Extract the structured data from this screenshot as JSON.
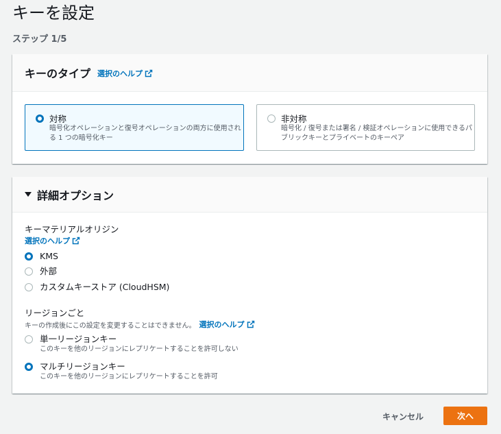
{
  "page": {
    "title": "キーを設定",
    "step": "ステップ 1/5"
  },
  "key_type": {
    "heading": "キーのタイプ",
    "help": "選択のヘルプ",
    "options": [
      {
        "label": "対称",
        "description": "暗号化オペレーションと復号オペレーションの両方に使用される 1 つの暗号化キー",
        "selected": true
      },
      {
        "label": "非対称",
        "description": "暗号化 / 復号または署名 / 検証オペレーションに使用できるパブリックキーとプライベートのキーペア",
        "selected": false
      }
    ]
  },
  "advanced": {
    "heading": "詳細オプション",
    "origin": {
      "label": "キーマテリアルオリジン",
      "help": "選択のヘルプ",
      "options": [
        {
          "label": "KMS",
          "selected": true
        },
        {
          "label": "外部",
          "selected": false
        },
        {
          "label": "カスタムキーストア (CloudHSM)",
          "selected": false
        }
      ]
    },
    "regionality": {
      "label": "リージョンごと",
      "description": "キーの作成後にこの設定を変更することはできません。",
      "help": "選択のヘルプ",
      "options": [
        {
          "label": "単一リージョンキー",
          "description": "このキーを他のリージョンにレプリケートすることを許可しない",
          "selected": false
        },
        {
          "label": "マルチリージョンキー",
          "description": "このキーを他のリージョンにレプリケートすることを許可",
          "selected": true
        }
      ]
    }
  },
  "actions": {
    "cancel": "キャンセル",
    "next": "次へ"
  },
  "colors": {
    "accent": "#0073bb",
    "primary_button": "#ec7211"
  }
}
